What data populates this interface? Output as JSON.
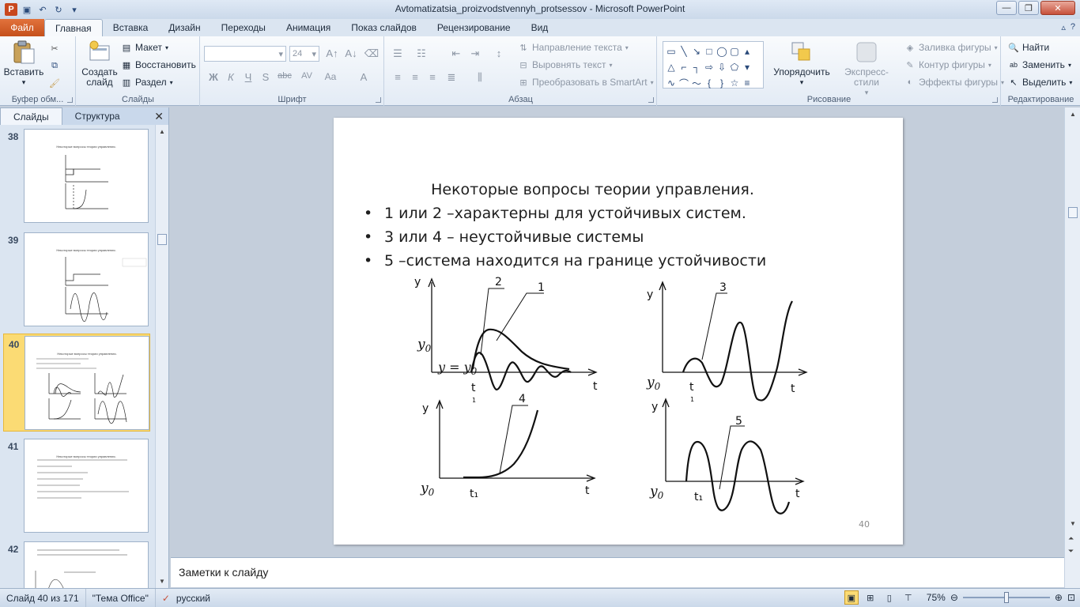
{
  "window": {
    "title": "Avtomatizatsia_proizvodstvennyh_protsessov - Microsoft PowerPoint"
  },
  "qat": {
    "icons": [
      "powerpoint-logo",
      "save-icon",
      "undo-icon",
      "redo-icon",
      "customize-icon"
    ]
  },
  "tabs": {
    "file": "Файл",
    "items": [
      "Главная",
      "Вставка",
      "Дизайн",
      "Переходы",
      "Анимация",
      "Показ слайдов",
      "Рецензирование",
      "Вид"
    ]
  },
  "ribbon": {
    "clipboard": {
      "paste": "Вставить",
      "label": "Буфер обм..."
    },
    "slides": {
      "new_slide": "Создать слайд",
      "layout": "Макет",
      "reset": "Восстановить",
      "section": "Раздел",
      "label": "Слайды"
    },
    "font": {
      "size": "24",
      "label": "Шрифт"
    },
    "paragraph": {
      "text_direction": "Направление текста",
      "align_text": "Выровнять текст",
      "smartart": "Преобразовать в SmartArt",
      "label": "Абзац"
    },
    "drawing": {
      "arrange": "Упорядочить",
      "quick_styles": "Экспресс-стили",
      "fill": "Заливка фигуры",
      "outline": "Контур фигуры",
      "effects": "Эффекты фигуры",
      "label": "Рисование"
    },
    "editing": {
      "find": "Найти",
      "replace": "Заменить",
      "select": "Выделить",
      "label": "Редактирование"
    }
  },
  "left_pane": {
    "tab_slides": "Слайды",
    "tab_outline": "Структура",
    "thumbs": [
      {
        "num": "38",
        "title": "Некоторые вопросы теории управления.",
        "selected": false
      },
      {
        "num": "39",
        "title": "Некоторые вопросы теории управления.",
        "selected": false
      },
      {
        "num": "40",
        "title": "Некоторые вопросы теории управления.",
        "selected": true
      },
      {
        "num": "41",
        "title": "Некоторые вопросы теории управления.",
        "selected": false
      },
      {
        "num": "42",
        "title": "",
        "selected": false
      }
    ]
  },
  "slide": {
    "title": "Некоторые вопросы теории управления.",
    "bullets": [
      "1 или 2 –характерны для устойчивых систем.",
      "3 или 4 – неустойчивые системы",
      "5 –система находится на границе устойчивости"
    ],
    "number": "40",
    "graphs": {
      "y": "y",
      "t": "t",
      "y0": "y",
      "y0_sub": "0",
      "t1_main": "t",
      "t1_sub": "1",
      "t1_combined": "t₁",
      "eq": "y = y",
      "labels": [
        "1",
        "2",
        "3",
        "4",
        "5"
      ]
    }
  },
  "notes": {
    "placeholder": "Заметки к слайду"
  },
  "status": {
    "slide_info": "Слайд 40 из 171",
    "theme": "\"Тема Office\"",
    "language": "русский",
    "zoom": "75%"
  }
}
